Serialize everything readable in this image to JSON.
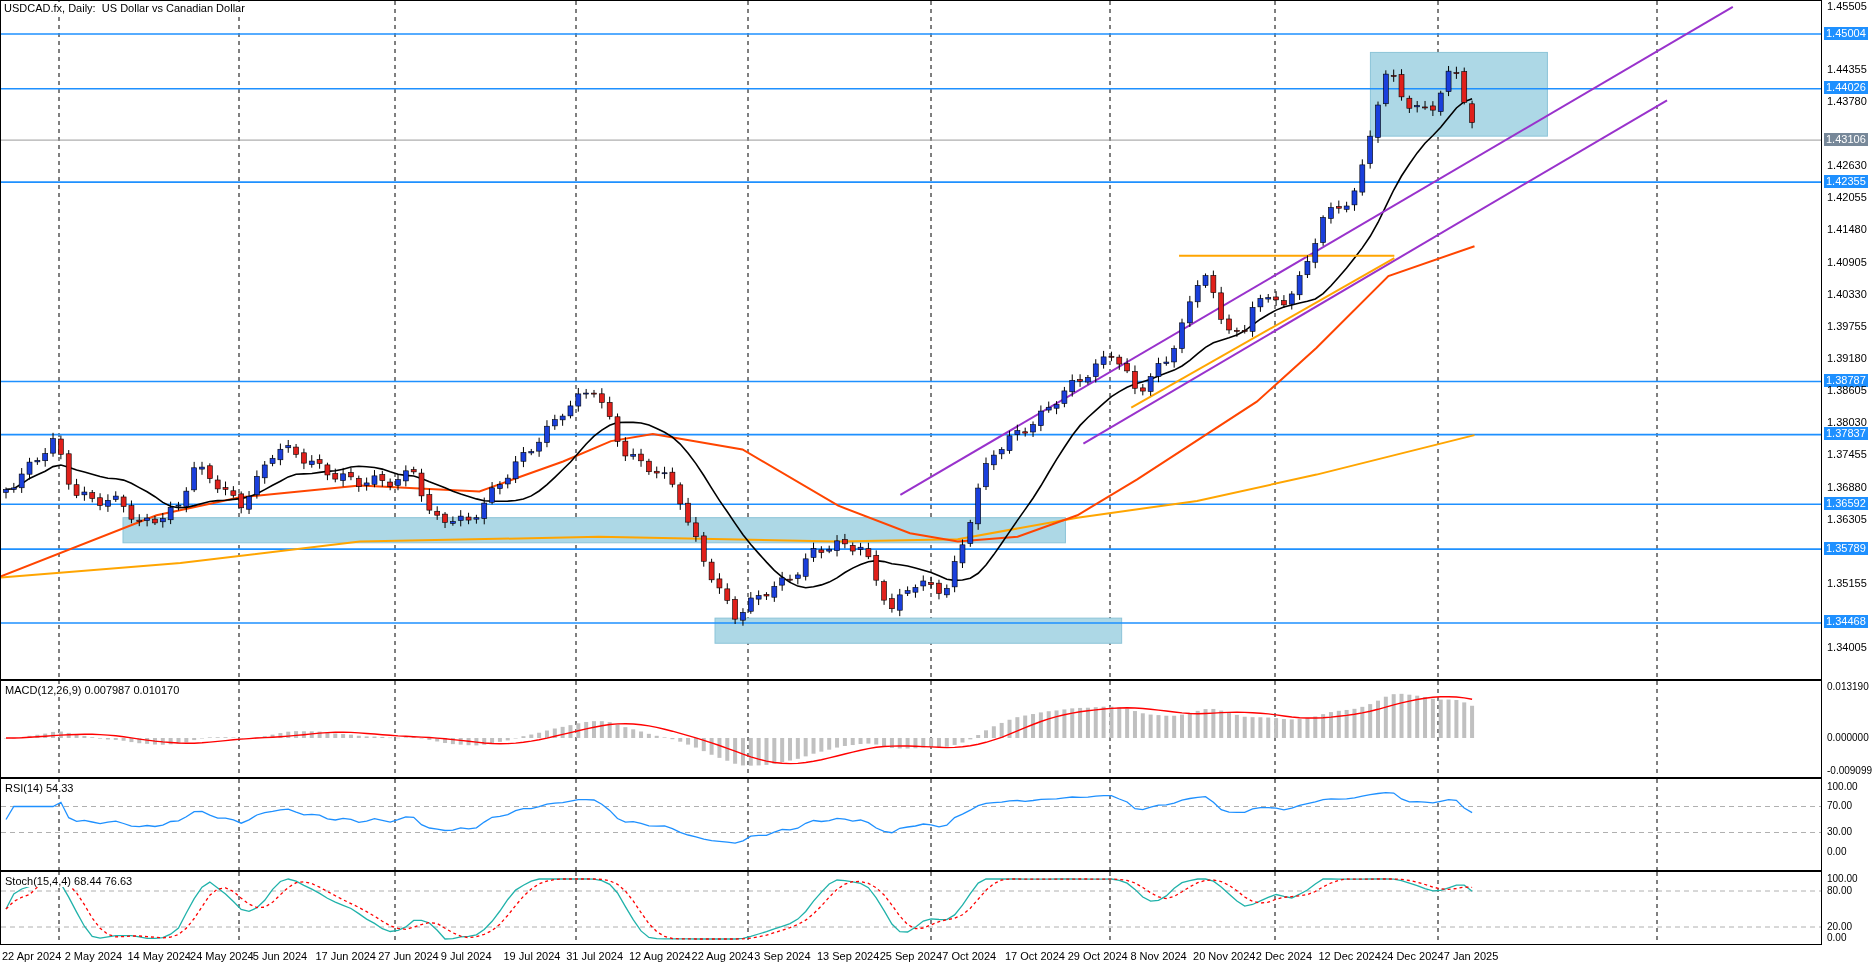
{
  "title": "USDCAD.fx, Daily:  US Dollar vs Canadian Dollar",
  "price_axis": {
    "ticks": [
      "1.45505",
      "1.44355",
      "1.43780",
      "1.42630",
      "1.42055",
      "1.41480",
      "1.40905",
      "1.40330",
      "1.39755",
      "1.39180",
      "1.38605",
      "1.38030",
      "1.37455",
      "1.36880",
      "1.36305",
      "1.35155",
      "1.34005"
    ],
    "levels": [
      {
        "label": "1.45004",
        "kind": "level"
      },
      {
        "label": "1.44026",
        "kind": "level"
      },
      {
        "label": "1.43106",
        "kind": "current"
      },
      {
        "label": "1.42355",
        "kind": "level"
      },
      {
        "label": "1.38787",
        "kind": "level"
      },
      {
        "label": "1.37837",
        "kind": "level"
      },
      {
        "label": "1.36592",
        "kind": "level"
      },
      {
        "label": "1.35789",
        "kind": "level"
      },
      {
        "label": "1.34468",
        "kind": "level"
      }
    ]
  },
  "macd": {
    "label": "MACD(12,26,9) 0.007987 0.010170",
    "ticks": [
      "0.013190",
      "0.000000",
      "-0.009099"
    ]
  },
  "rsi": {
    "label": "RSI(14) 54.33",
    "ticks": [
      "100.00",
      "70.00",
      "30.00",
      "0.00"
    ]
  },
  "stoch": {
    "label": "Stoch(15,4,4) 68.44 76.63",
    "ticks": [
      "100.00",
      "80.00",
      "20.00",
      "0.00"
    ]
  },
  "time_axis": {
    "labels": [
      "22 Apr 2024",
      "2 May 2024",
      "14 May 2024",
      "24 May 2024",
      "5 Jun 2024",
      "17 Jun 2024",
      "27 Jun 2024",
      "9 Jul 2024",
      "19 Jul 2024",
      "31 Jul 2024",
      "12 Aug 2024",
      "22 Aug 2024",
      "3 Sep 2024",
      "13 Sep 2024",
      "25 Sep 2024",
      "7 Oct 2024",
      "17 Oct 2024",
      "29 Oct 2024",
      "8 Nov 2024",
      "20 Nov 2024",
      "2 Dec 2024",
      "12 Dec 2024",
      "24 Dec 2024",
      "7 Jan 2025"
    ]
  }
}
